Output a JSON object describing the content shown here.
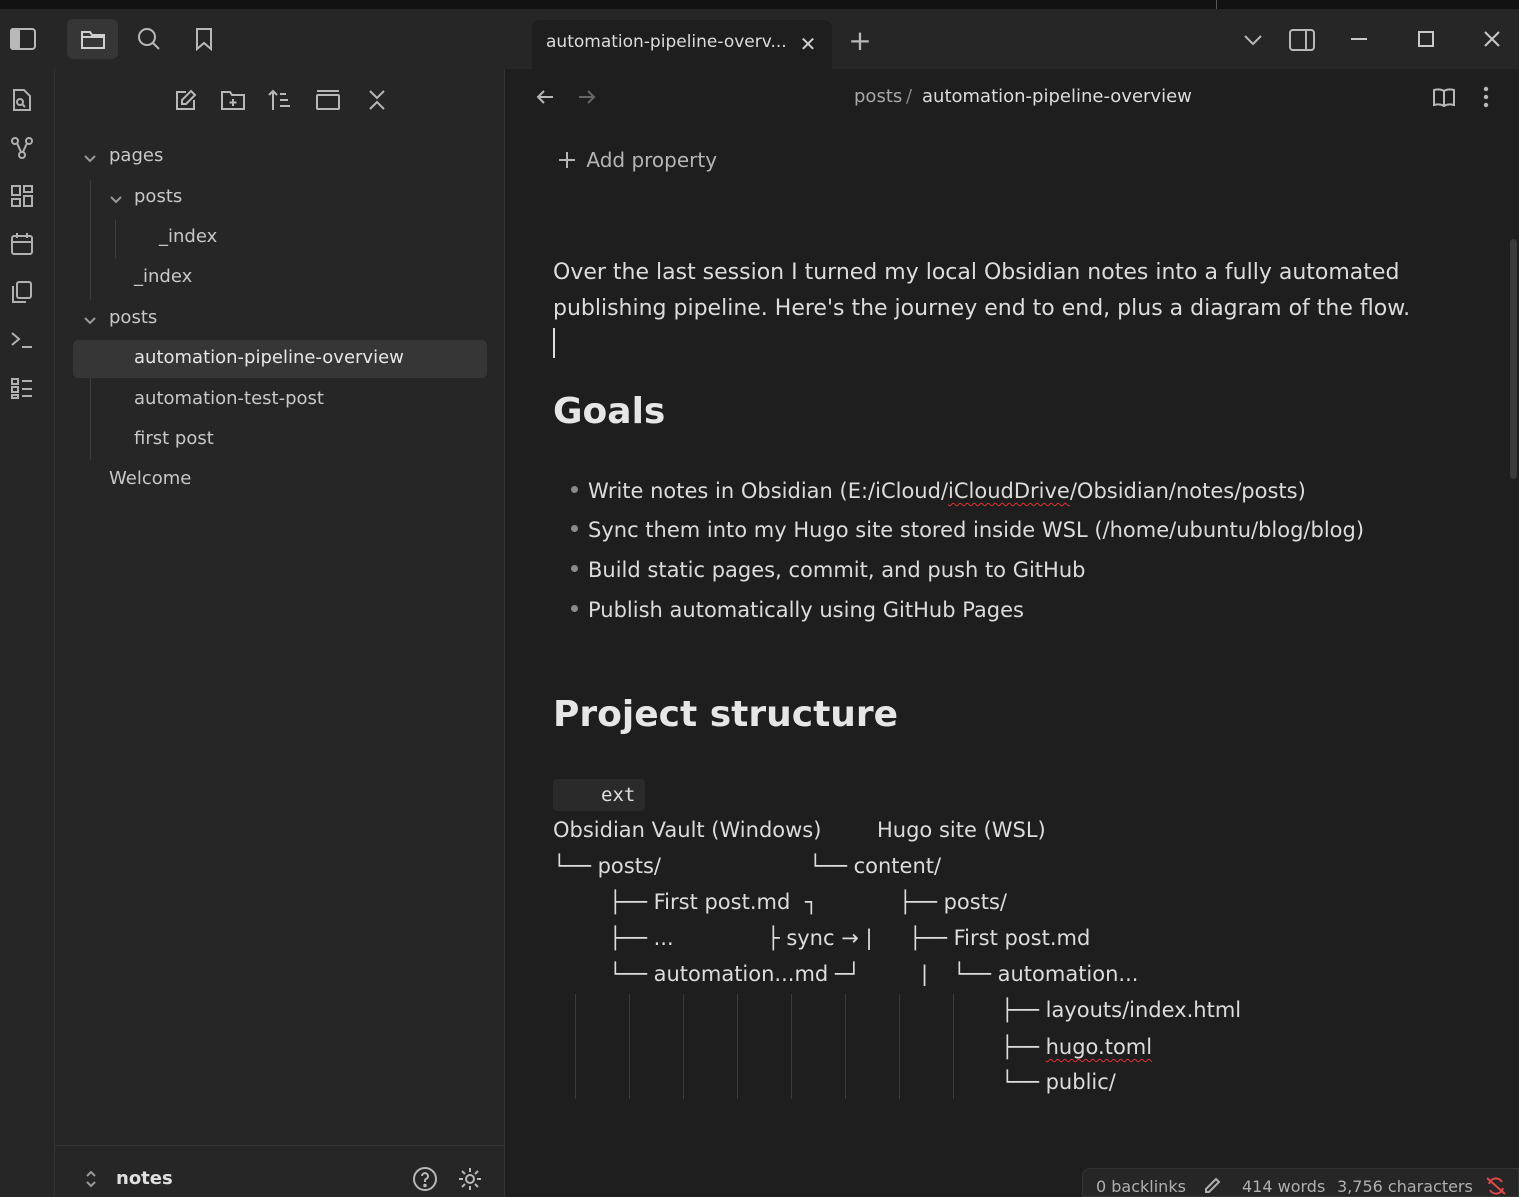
{
  "tab": {
    "title": "automation-pipeline-overv...",
    "close": "✕",
    "new": "+"
  },
  "breadcrumb": {
    "folder": "posts",
    "separator": "/",
    "note": "automation-pipeline-overview"
  },
  "file_tree": {
    "items": [
      {
        "label": "pages"
      },
      {
        "label": "posts"
      },
      {
        "label": "_index"
      },
      {
        "label": "_index"
      },
      {
        "label": "posts"
      },
      {
        "label": "automation-pipeline-overview"
      },
      {
        "label": "automation-test-post"
      },
      {
        "label": "first post"
      },
      {
        "label": "Welcome"
      }
    ]
  },
  "vault": {
    "name": "notes"
  },
  "note": {
    "add_property": "Add property",
    "intro": "Over the last session I turned my local Obsidian notes into a fully automated publishing pipeline. Here's the journey end to end, plus a diagram of the flow.",
    "goals_heading": "Goals",
    "goals": [
      {
        "pre": "Write notes in Obsidian (E:/iCloud/",
        "mis": "iCloudDrive",
        "post": "/Obsidian/notes/posts)"
      },
      {
        "pre": "Sync them into my Hugo site stored inside WSL (/home/ubuntu/blog/blog)",
        "mis": "",
        "post": ""
      },
      {
        "pre": "Build static pages, commit, and push to GitHub",
        "mis": "",
        "post": ""
      },
      {
        "pre": "Publish automatically using GitHub Pages",
        "mis": "",
        "post": ""
      }
    ],
    "structure_heading": "Project structure",
    "code_chip": "ext",
    "diagram": {
      "vault_title": "Obsidian Vault (Windows)",
      "site_title": "Hugo site (WSL)",
      "l1": "└── posts/",
      "l1b": "└── content/",
      "l2": "├── First post.md",
      "l2a": "┐",
      "l2b": "├── posts/",
      "l3": "├── ...",
      "l3a": "├ sync → |",
      "l3b": "├── First post.md",
      "l4": "└── automation...md ─┘",
      "l4a": "|",
      "l4b": "└── automation...",
      "l5": "├── layouts/index.html",
      "l6_prefix": "├── ",
      "l6_name": "hugo.toml",
      "l7": "└── public/"
    }
  },
  "status": {
    "backlinks": "0 backlinks",
    "words": "414 words",
    "characters": "3,756 characters"
  }
}
